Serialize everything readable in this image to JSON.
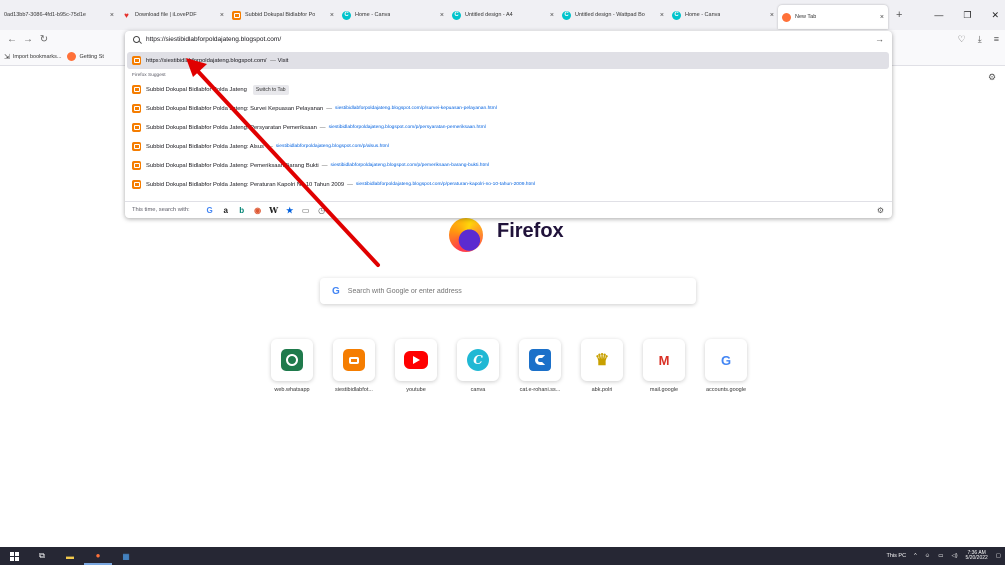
{
  "tabs": [
    {
      "title": "0ad13bb7-3086-4fd1-b95c-75d1e",
      "icon": "none"
    },
    {
      "title": "Download file | iLovePDF",
      "icon": "ilovepdf-icon"
    },
    {
      "title": "Subbid Dokupal Bidlabfor Po",
      "icon": "blogger-icon"
    },
    {
      "title": "Home - Canva",
      "icon": "canva-icon"
    },
    {
      "title": "Untitled design - A4",
      "icon": "canva-icon"
    },
    {
      "title": "Untitled design - Wattpad Bo",
      "icon": "canva-icon"
    },
    {
      "title": "Home - Canva",
      "icon": "canva-icon"
    },
    {
      "title": "New Tab",
      "icon": "firefox-icon",
      "active": true
    }
  ],
  "bookmarks": [
    {
      "label": "Import bookmarks..."
    },
    {
      "label": "Getting St"
    }
  ],
  "urlbar": {
    "value": "https://siestibidlabforpoldajateng.blogspot.com/"
  },
  "suggestions": {
    "visit_url": "https://siestibidlabforpoldajateng.blogspot.com/",
    "visit_label": "Visit",
    "section_heading": "Firefox Suggest",
    "items": [
      {
        "title": "Subbid Dokupal Bidlabfor Polda Jateng",
        "url": "",
        "badge": "Switch to Tab"
      },
      {
        "title": "Subbid Dokupal Bidlabfor Polda Jateng: Survei Kepuasan Pelayanan",
        "url": "siestibidlabforpoldajateng.blogspot.com/p/survei-kepuasan-pelayanan.html",
        "badge": ""
      },
      {
        "title": "Subbid Dokupal Bidlabfor Polda Jateng: Persyaratan Pemeriksaan",
        "url": "siestibidlabforpoldajateng.blogspot.com/p/persyaratan-pemeriksaan.html",
        "badge": ""
      },
      {
        "title": "Subbid Dokupal Bidlabfor Polda Jateng: Alsus",
        "url": "siestibidlabforpoldajateng.blogspot.com/p/alsus.html",
        "badge": ""
      },
      {
        "title": "Subbid Dokupal Bidlabfor Polda Jateng: Pemeriksaan Barang Bukti",
        "url": "siestibidlabforpoldajateng.blogspot.com/p/pemeriksaan-barang-bukti.html",
        "badge": ""
      },
      {
        "title": "Subbid Dokupal Bidlabfor Polda Jateng: Peraturan Kapolri No.10 Tahun 2009",
        "url": "siestibidlabforpoldajateng.blogspot.com/p/peraturan-kapolri-no-10-tahun-2009.html",
        "badge": ""
      }
    ],
    "search_with_label": "This time, search with:"
  },
  "newtab": {
    "brand": "Firefox",
    "search_placeholder": "Search with Google or enter address",
    "shortcuts": [
      {
        "label": "web.whatsapp",
        "icon": "whatsapp-icon"
      },
      {
        "label": "siestibidlabfot...",
        "icon": "blogger-icon"
      },
      {
        "label": "youtube",
        "icon": "youtube-icon"
      },
      {
        "label": "canva",
        "icon": "canva-icon"
      },
      {
        "label": "cat.e-rohani.ss...",
        "icon": "cat-icon"
      },
      {
        "label": "abk.polri",
        "icon": "polri-emblem-icon"
      },
      {
        "label": "mail.google",
        "icon": "gmail-icon"
      },
      {
        "label": "accounts.google",
        "icon": "google-icon"
      }
    ]
  },
  "taskbar": {
    "tray_label": "This PC",
    "time": "7:36 AM",
    "date": "5/20/2022"
  },
  "colors": {
    "accent": "#0060df",
    "annotation_arrow": "#e00000",
    "taskbar": "#262734"
  }
}
